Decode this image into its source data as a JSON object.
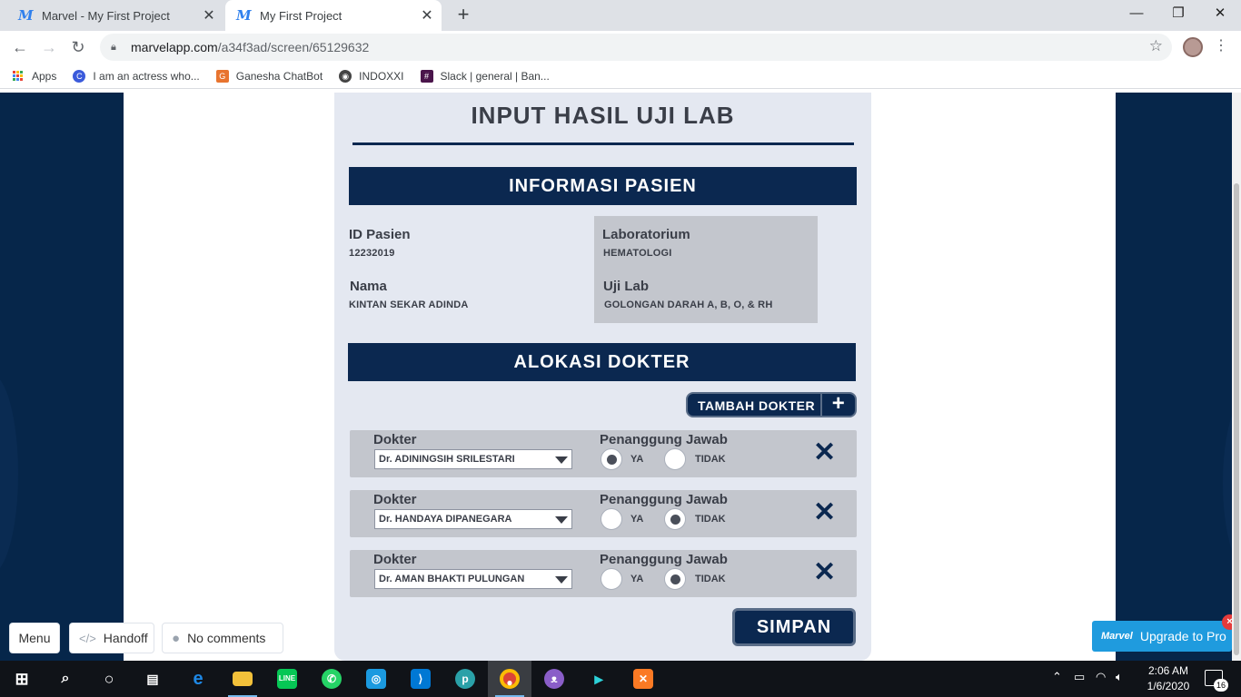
{
  "browser": {
    "tabs": [
      {
        "title": "Marvel - My First Project",
        "favicon": "marvel-icon",
        "active": false
      },
      {
        "title": "My First Project",
        "favicon": "marvel-icon",
        "active": true
      }
    ],
    "url_host": "marvelapp.com",
    "url_path": "/a34f3ad/screen/65129632",
    "bookmarks": [
      {
        "label": "Apps",
        "icon": "apps-grid-icon"
      },
      {
        "label": "I am an actress who...",
        "icon": "c-icon"
      },
      {
        "label": "Ganesha ChatBot",
        "icon": "ganesha-icon"
      },
      {
        "label": "INDOXXI",
        "icon": "indoxxi-icon"
      },
      {
        "label": "Slack | general | Ban...",
        "icon": "slack-icon"
      }
    ]
  },
  "form": {
    "title": "INPUT HASIL UJI LAB",
    "patient_section": "INFORMASI PASIEN",
    "patient": {
      "id_label": "ID Pasien",
      "id_value": "12232019",
      "name_label": "Nama",
      "name_value": "KINTAN SEKAR ADINDA",
      "lab_label": "Laboratorium",
      "lab_value": "HEMATOLOGI",
      "test_label": "Uji Lab",
      "test_value": "GOLONGAN DARAH A, B, O, & RH"
    },
    "doctor_section": "ALOKASI DOKTER",
    "add_doctor_label": "TAMBAH DOKTER",
    "add_doctor_plus": "+",
    "doctor_label": "Dokter",
    "responsible_label": "Penanggung Jawab",
    "yes_label": "YA",
    "no_label": "TIDAK",
    "doctors": [
      {
        "name": "Dr. ADININGSIH SRILESTARI",
        "responsible": "YA"
      },
      {
        "name": "Dr. HANDAYA DIPANEGARA",
        "responsible": "TIDAK"
      },
      {
        "name": "Dr. AMAN BHAKTI PULUNGAN",
        "responsible": "TIDAK"
      }
    ],
    "remove_glyph": "✕",
    "save_label": "SIMPAN"
  },
  "marvel": {
    "menu_label": "Menu",
    "handoff_label": "Handoff",
    "comments_label": "No comments",
    "upgrade_label": "Upgrade to Pro",
    "upgrade_logo": "Marvel",
    "upgrade_close": "×"
  },
  "taskbar": {
    "time": "2:06 AM",
    "date": "1/6/2020",
    "notification_count": "16",
    "apps": [
      "start-icon",
      "search-icon",
      "cortana-icon",
      "task-view-icon",
      "edge-icon",
      "file-explorer-icon",
      "line-icon",
      "whatsapp-icon",
      "instagram-icon",
      "vscode-icon",
      "pcloud-icon",
      "chrome-icon",
      "cat-app-icon",
      "powershell-icon",
      "xampp-icon"
    ]
  },
  "colors": {
    "navy": "#0b2850",
    "panel": "#e4e8f1",
    "grey_box": "#c3c6cd",
    "marvel_blue": "#1f9bde"
  }
}
